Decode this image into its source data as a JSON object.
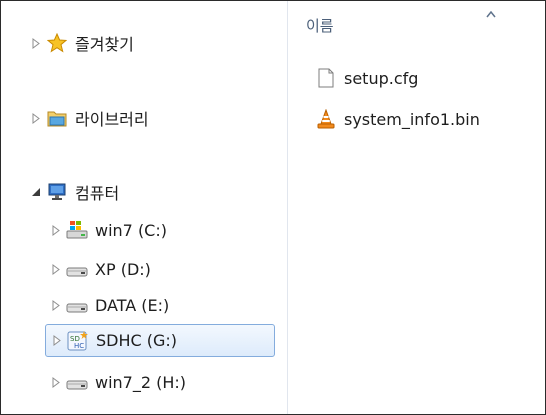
{
  "nav": {
    "favorites": "즐겨찾기",
    "libraries": "라이브러리",
    "computer": "컴퓨터",
    "drives": [
      {
        "label": "win7 (C:)",
        "icon": "windows-drive-icon"
      },
      {
        "label": "XP (D:)",
        "icon": "hard-drive-icon"
      },
      {
        "label": "DATA (E:)",
        "icon": "hard-drive-icon"
      },
      {
        "label": "SDHC (G:)",
        "icon": "sdhc-card-icon",
        "selected": true
      },
      {
        "label": "win7_2 (H:)",
        "icon": "hard-drive-icon"
      }
    ]
  },
  "content": {
    "column_name": "이름",
    "files": [
      {
        "name": "setup.cfg",
        "icon": "document-file-icon"
      },
      {
        "name": "system_info1.bin",
        "icon": "vlc-cone-icon"
      }
    ]
  },
  "colors": {
    "selection_border": "#84acdd",
    "selection_fill": "#ddebfb",
    "column_header_text": "#4c607a"
  }
}
